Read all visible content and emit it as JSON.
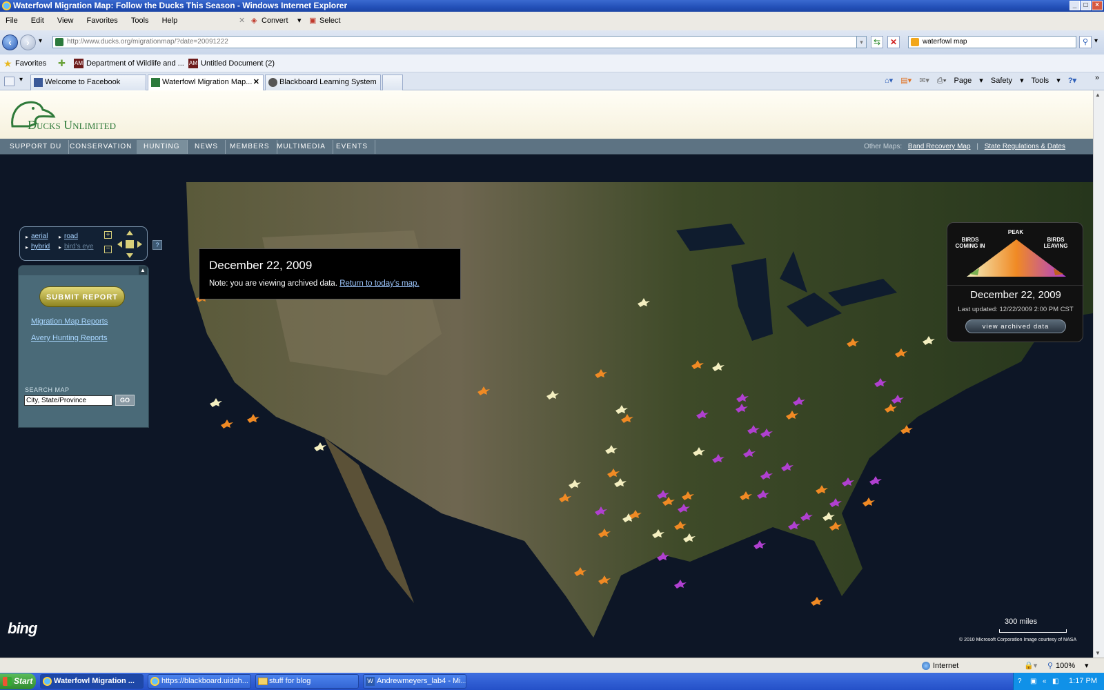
{
  "window": {
    "title": "Waterfowl Migration Map: Follow the Ducks This Season - Windows Internet Explorer"
  },
  "menu": {
    "items": [
      "File",
      "Edit",
      "View",
      "Favorites",
      "Tools",
      "Help"
    ],
    "convert_label": "Convert",
    "select_label": "Select"
  },
  "address": {
    "url": "http://www.ducks.org/migrationmap/?date=20091222",
    "search_value": "waterfowl map"
  },
  "favorites": {
    "label": "Favorites",
    "items": [
      "Department of Wildlife and ...",
      "Untitled Document (2)"
    ]
  },
  "tabs": [
    {
      "label": "Welcome to Facebook",
      "icon": "facebook-icon"
    },
    {
      "label": "Waterfowl Migration Map...",
      "icon": "ducks-icon",
      "active": true
    },
    {
      "label": "Blackboard Learning System",
      "icon": "blackboard-icon"
    }
  ],
  "commandbar": {
    "page": "Page",
    "safety": "Safety",
    "tools": "Tools"
  },
  "site": {
    "logo_text": "Ducks Unlimited",
    "nav": [
      "SUPPORT DU",
      "CONSERVATION",
      "HUNTING",
      "NEWS",
      "MEMBERS",
      "MULTIMEDIA",
      "EVENTS"
    ],
    "nav_active": "HUNTING",
    "other_maps_label": "Other Maps:",
    "other_maps": [
      "Band Recovery Map",
      "State Regulations & Dates"
    ]
  },
  "mapcontrols": {
    "aerial": "aerial",
    "road": "road",
    "hybrid": "hybrid",
    "birdseye": "bird's eye",
    "help": "?"
  },
  "sidepanel": {
    "submit": "SUBMIT REPORT",
    "links": [
      "Migration Map Reports",
      "Avery Hunting Reports"
    ],
    "search_label": "SEARCH MAP",
    "search_value": "City, State/Province",
    "go": "GO"
  },
  "archive": {
    "date": "December 22, 2009",
    "note": "Note: you are viewing archived data.",
    "link": "Return to today's map."
  },
  "legend": {
    "peak": "PEAK",
    "coming": "BIRDS COMING IN",
    "leaving": "BIRDS LEAVING",
    "date": "December 22, 2009",
    "updated": "Last updated: 12/22/2009 2:00 PM CST",
    "button": "view archived data",
    "colors": {
      "coming": "#f4efc0",
      "peak": "#f08a24",
      "leaving": "#b040d0"
    }
  },
  "map": {
    "brand": "bing",
    "scale": "300 miles",
    "copyright": "© 2010 Microsoft Corporation    Image courtesy of NASA"
  },
  "status": {
    "zone": "Internet",
    "zoom": "100%"
  },
  "taskbar": {
    "start": "Start",
    "items": [
      "Waterfowl Migration ...",
      "https://blackboard.uidah...",
      "stuff for blog",
      "Andrewmeyers_lab4 - Mi..."
    ],
    "time": "1:17 PM"
  }
}
